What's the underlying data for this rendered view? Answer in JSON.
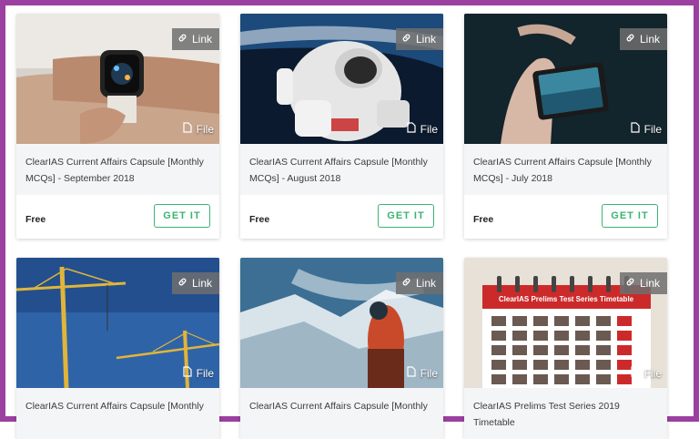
{
  "badges": {
    "link_label": "Link",
    "file_label": "File"
  },
  "cards": [
    {
      "title": "ClearIAS Current Affairs Capsule [Monthly MCQs] - September 2018",
      "price": "Free",
      "button": "GET IT"
    },
    {
      "title": "ClearIAS Current Affairs Capsule [Monthly MCQs] - August 2018",
      "price": "Free",
      "button": "GET IT"
    },
    {
      "title": "ClearIAS Current Affairs Capsule [Monthly MCQs] - July 2018",
      "price": "Free",
      "button": "GET IT"
    },
    {
      "title": "ClearIAS Current Affairs Capsule [Monthly",
      "price": "",
      "button": ""
    },
    {
      "title": "ClearIAS Current Affairs Capsule [Monthly",
      "price": "",
      "button": ""
    },
    {
      "title": "ClearIAS Prelims Test Series 2019 Timetable",
      "price": "",
      "button": "",
      "image_text": "ClearIAS Prelims Test Series Timetable"
    }
  ],
  "colors": {
    "frame": "#9b3fa0",
    "accent_green": "#3cb371",
    "calendar_red": "#cc2a2a"
  },
  "icons": {
    "link": "link-icon",
    "file": "file-icon"
  }
}
